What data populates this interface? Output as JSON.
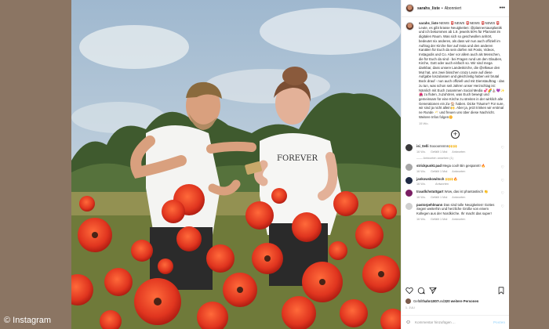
{
  "header": {
    "username": "sarahs_liste",
    "separator": "•",
    "follow_state": "Abonniert",
    "more_icon": "more-horizontal-icon"
  },
  "caption": {
    "username": "sarahs_liste",
    "text": " NEWS 📮NEWS 📮NEWS 📮NEWS 📮 Leute, es gibt krasse Neuigkeiten: @plannersausplastik und ich bekommen ab 1.8. jeweils 50% für Pfarramt im digitalen Raum. Was sich so geschwollen anhört, bedeutet nix anderes, als dass wir nun auch offiziell im Auftrag der Kirche hier auf Insta und den anderen Kanälen für Euch da sein dürfen mit Posts, Videos, Instagodis und Co. Aber vor allem auch als Menschen, die für Euch da sind - bei Fragen rund um den Glauben, Kirche, Gott oder auch einfach so. Wir sind mega dankbar, dass unsere Landeskirche, die @elkwue den Mut hat, uns zwei bisschen crazy Leute auf diese Aufgabe loszulassen und gleichzeitig haben wir brutal Bock drauf - nun auch offiziell und mit Dienstauftrag - das zu tun, was schon seit Jahren unser Herzschlag ist: Nämlich mit Euch zusammen Social Media 💞🌈⛪️💜✨🌺 zu fluten, zuzuhören, was Euch bewegt und gemeinsam für eine Kirche zu streiten in der wirklich alle Generationen ein Zu-🏠 haben. Dicke Träume? Für sure, wir sind ja nicht allein🙌. Aber ja, jetzt trinken wir erstmal ne Runde 🥂 und freuen uns über diese Nachricht. Weitere Infos folgen🌼",
    "time": "15 Wo."
  },
  "load_more_icon": "plus-circle-icon",
  "comments": [
    {
      "user": "isi_0elli",
      "text": "Soooonnnnn🙌🙌",
      "time": "16 Wo.",
      "likes": "Gefällt 1 Mal",
      "reply": "Antworten",
      "avatar_color": "#3a3a3a",
      "view_replies": "Antworten ansehen (1)"
    },
    {
      "user": "strickpunkt.pad",
      "text": "Mega cool! Bin gespannt! 🔥",
      "time": "16 Wo.",
      "likes": "Gefällt 1 Mal",
      "reply": "Antworten",
      "avatar_color": "#a7a7a7",
      "view_replies": ""
    },
    {
      "user": "jankowskowitsch",
      "text": "🙌🙌🔥",
      "time": "16 Wo.",
      "likes": "",
      "reply": "Antworten",
      "avatar_color": "#1f2a44",
      "view_replies": ""
    },
    {
      "user": "traudlchstuttgart",
      "text": "Wow, das ist phantastisch 👏",
      "time": "16 Wo.",
      "likes": "Gefällt 1 Mal",
      "reply": "Antworten",
      "avatar_color": "#7a1e63",
      "view_replies": ""
    },
    {
      "user": "pastorpehlmann",
      "text": "Das sind tolle Neuigkeiten! Gottes Segen weiterhin und herzliche Grüße von einem Kollegen aus der Nordkirche. Ihr macht das super!",
      "time": "16 Wo.",
      "likes": "Gefällt 1 Mal",
      "reply": "Antworten",
      "avatar_color": "#d0d0d0",
      "view_replies": ""
    }
  ],
  "actions": {
    "like_icon": "heart-icon",
    "comment_icon": "comment-icon",
    "share_icon": "paper-plane-icon",
    "save_icon": "bookmark-icon"
  },
  "likes": {
    "prefix": "Gefällt ",
    "user": "hahn1807",
    "middle": " und ",
    "rest": "320 weitere Personen"
  },
  "date": "1. JULI",
  "add_comment": {
    "emoji_icon": "smiley-icon",
    "placeholder": "Kommentar hinzufügen ...",
    "post_label": "Posten"
  },
  "credit": "© Instagram",
  "colors": {
    "background": "#8b7563",
    "poppy_red": "#e0351f",
    "sky": "#aec6dc",
    "link_blue": "#b2dffc"
  }
}
